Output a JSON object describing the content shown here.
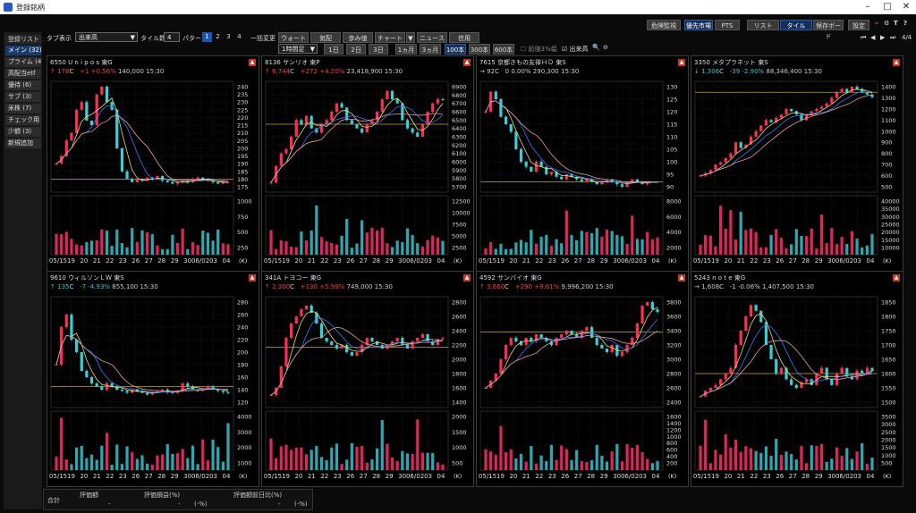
{
  "window": {
    "title": "登録銘柄"
  },
  "topbar": {
    "buttons": [
      "危険監視",
      "優先市場",
      "PTS",
      "リスト",
      "タイル",
      "保存ボード",
      "設定"
    ],
    "active": [
      "優先市場",
      "タイル"
    ]
  },
  "sidebar": {
    "header": "登録リスト",
    "items": [
      "メイン (32)",
      "プライム (4)",
      "高配当etf",
      "優待 (6)",
      "サブ (3)",
      "米株 (7)",
      "チェック用 (",
      "少額 (3)",
      "新規追加"
    ]
  },
  "toolbar1": {
    "tab_label": "タブ表示",
    "tab_value": "出来高",
    "tile_label": "タイル数",
    "tile_value": "4",
    "pattern_label": "パターン",
    "patterns": [
      "1",
      "2",
      "3",
      "4"
    ],
    "bulk_label": "一括変更",
    "buttons": [
      "ウォート",
      "気配",
      "歩み値",
      "チャート",
      "ニュース",
      "信用"
    ],
    "page": "4/4"
  },
  "toolbar2": {
    "period_value": "1時間足",
    "ranges": [
      "1日",
      "2日",
      "3日",
      "1ヵ月",
      "3ヵ月",
      "100本",
      "300本",
      "600本"
    ],
    "active_range": "100本",
    "opt1": "前値3%幅",
    "opt2": "出来高"
  },
  "tiles": [
    {
      "code": "6550",
      "name": "U n i p o s",
      "market": "東G",
      "arrow": "↑",
      "price": "178",
      "mark": "C",
      "change": "+1",
      "pct": "+0.56%",
      "volume": "140,000",
      "time": "15:30",
      "dir": "up",
      "yticks": [
        "240",
        "235",
        "230",
        "225",
        "220",
        "215",
        "210",
        "205",
        "200",
        "195",
        "190",
        "185",
        "180",
        "175"
      ],
      "vticks": [
        "1000",
        "750",
        "500",
        "250"
      ],
      "series": [
        190,
        195,
        205,
        210,
        225,
        230,
        218,
        215,
        235,
        240,
        230,
        225,
        200,
        185,
        180,
        178,
        180,
        179,
        181,
        180,
        182,
        179,
        178,
        177,
        178,
        179,
        178,
        180,
        181,
        180,
        179,
        178,
        177,
        178,
        178
      ],
      "ref": 180
    },
    {
      "code": "8136",
      "name": "サンリオ",
      "market": "東P",
      "arrow": "↑",
      "price": "6,744",
      "mark": "C",
      "change": "+272",
      "pct": "+4.20%",
      "volume": "23,418,900",
      "time": "15:30",
      "dir": "up",
      "yticks": [
        "6900",
        "6800",
        "6700",
        "6600",
        "6500",
        "6400",
        "6300",
        "6200",
        "6100",
        "6000",
        "5900",
        "5800",
        "5700"
      ],
      "vticks": [
        "12500",
        "10000",
        "7500",
        "5000",
        "2500"
      ],
      "series": [
        5750,
        5950,
        6100,
        6150,
        6300,
        6500,
        6450,
        6550,
        6400,
        6350,
        6450,
        6500,
        6600,
        6700,
        6650,
        6500,
        6450,
        6400,
        6350,
        6450,
        6500,
        6600,
        6750,
        6850,
        6750,
        6700,
        6500,
        6400,
        6350,
        6300,
        6450,
        6600,
        6700,
        6750,
        6744
      ],
      "ref": 6450
    },
    {
      "code": "7615",
      "name": "京都きもの友禅ＨＤ",
      "market": "東S",
      "arrow": "→",
      "price": "92",
      "mark": "C",
      "change": "0",
      "pct": "0.00%",
      "volume": "290,300",
      "time": "15:30",
      "dir": "flat",
      "yticks": [
        "130",
        "125",
        "120",
        "115",
        "110",
        "105",
        "100",
        "95",
        "90"
      ],
      "vticks": [
        "8000",
        "6000",
        "4000",
        "2000"
      ],
      "series": [
        120,
        128,
        125,
        118,
        115,
        112,
        105,
        100,
        98,
        96,
        100,
        98,
        95,
        96,
        94,
        93,
        95,
        94,
        93,
        92,
        93,
        92,
        91,
        92,
        93,
        92,
        91,
        90,
        92,
        93,
        92,
        91,
        92,
        92,
        92
      ],
      "ref": 92
    },
    {
      "code": "3350",
      "name": "メタプラネット",
      "market": "東S",
      "arrow": "↓",
      "price": "1,306",
      "mark": "C",
      "change": "-39",
      "pct": "-2.90%",
      "volume": "88,346,400",
      "time": "15:30",
      "dir": "dn",
      "yticks": [
        "1400",
        "1300",
        "1200",
        "1100",
        "1000",
        "900",
        "800",
        "700",
        "600",
        "500"
      ],
      "vticks": [
        "40000",
        "35000",
        "30000",
        "25000",
        "20000",
        "15000",
        "10000"
      ],
      "series": [
        600,
        620,
        650,
        700,
        720,
        760,
        800,
        900,
        850,
        880,
        950,
        1000,
        1050,
        1100,
        1080,
        1120,
        1150,
        1200,
        1180,
        1150,
        1100,
        1150,
        1180,
        1200,
        1220,
        1250,
        1300,
        1350,
        1380,
        1350,
        1400,
        1380,
        1350,
        1330,
        1306
      ],
      "ref": 1350
    },
    {
      "code": "9610",
      "name": "ウィルソンＬＷ",
      "market": "東S",
      "arrow": "↑",
      "price": "135",
      "mark": "C",
      "change": "-7",
      "pct": "-4.93%",
      "volume": "855,100",
      "time": "15:30",
      "dir": "dn",
      "yticks": [
        "280",
        "260",
        "240",
        "220",
        "200",
        "180",
        "160",
        "140",
        "120"
      ],
      "vticks": [
        "4000",
        "3000",
        "2000",
        "1000"
      ],
      "series": [
        180,
        240,
        260,
        220,
        200,
        170,
        160,
        150,
        145,
        140,
        150,
        145,
        140,
        138,
        135,
        140,
        137,
        135,
        132,
        135,
        138,
        140,
        136,
        135,
        138,
        150,
        145,
        140,
        138,
        142,
        145,
        140,
        138,
        136,
        135
      ],
      "ref": 145
    },
    {
      "code": "341A",
      "name": "トヨコー",
      "market": "東G",
      "arrow": "↑",
      "price": "2,300",
      "mark": "C",
      "change": "+130",
      "pct": "+5.99%",
      "volume": "749,000",
      "time": "15:30",
      "dir": "up",
      "yticks": [
        "2800",
        "2600",
        "2400",
        "2200",
        "2000",
        "1800",
        "1600",
        "1400"
      ],
      "vticks": [
        "2000",
        "1500",
        "1000",
        "500"
      ],
      "series": [
        1500,
        1600,
        1900,
        2300,
        2500,
        2600,
        2700,
        2750,
        2650,
        2500,
        2300,
        2250,
        2200,
        2150,
        2200,
        2100,
        2050,
        2100,
        2200,
        2300,
        2250,
        2200,
        2150,
        2200,
        2250,
        2300,
        2200,
        2150,
        2250,
        2300,
        2350,
        2250,
        2200,
        2280,
        2300
      ],
      "ref": 2170
    },
    {
      "code": "4592",
      "name": "サンバイオ",
      "market": "東G",
      "arrow": "↑",
      "price": "3,660",
      "mark": "C",
      "change": "+290",
      "pct": "+8.61%",
      "volume": "9,996,200",
      "time": "15:30",
      "dir": "up",
      "yticks": [
        "3800",
        "3600",
        "3400",
        "3200",
        "3000",
        "2800",
        "2600",
        "2400"
      ],
      "vticks": [
        "1600",
        "1400",
        "1200",
        "1000",
        "800",
        "600",
        "400",
        "200"
      ],
      "series": [
        2600,
        2700,
        2800,
        3000,
        3200,
        3300,
        3250,
        3200,
        3300,
        3250,
        3350,
        3300,
        3250,
        3200,
        3300,
        3350,
        3400,
        3350,
        3300,
        3400,
        3450,
        3300,
        3200,
        3150,
        3100,
        3200,
        3050,
        3100,
        3200,
        3300,
        3500,
        3750,
        3800,
        3700,
        3660
      ],
      "ref": 3380
    },
    {
      "code": "5243",
      "name": "n o t e",
      "market": "東G",
      "arrow": "→",
      "price": "1,608",
      "mark": "C",
      "change": "-1",
      "pct": "-0.06%",
      "volume": "1,407,500",
      "time": "15:30",
      "dir": "flat",
      "yticks": [
        "1850",
        "1800",
        "1750",
        "1700",
        "1650",
        "1600",
        "1550",
        "1500"
      ],
      "vticks": [
        "3500",
        "3000",
        "2500",
        "2000",
        "1500",
        "1000",
        "500"
      ],
      "series": [
        1520,
        1540,
        1550,
        1560,
        1580,
        1600,
        1620,
        1700,
        1750,
        1800,
        1840,
        1820,
        1780,
        1700,
        1650,
        1600,
        1620,
        1580,
        1560,
        1550,
        1570,
        1580,
        1560,
        1600,
        1620,
        1580,
        1560,
        1600,
        1620,
        1590,
        1580,
        1610,
        1600,
        1620,
        1608
      ],
      "ref": 1600
    }
  ],
  "xticks": [
    "05/15",
    "19",
    "20",
    "21",
    "22",
    "23",
    "26",
    "27",
    "28",
    "29",
    "30",
    "06/02",
    "03",
    "04"
  ],
  "unit": "(K)",
  "bottom": {
    "label": "合計",
    "col1": "評価額",
    "col2": "評価損益(%)",
    "col3": "評価額前日比(%)",
    "v1": "-",
    "v2": "-",
    "v2b": "(-%)",
    "v3": "-",
    "v3b": "(-%)"
  }
}
